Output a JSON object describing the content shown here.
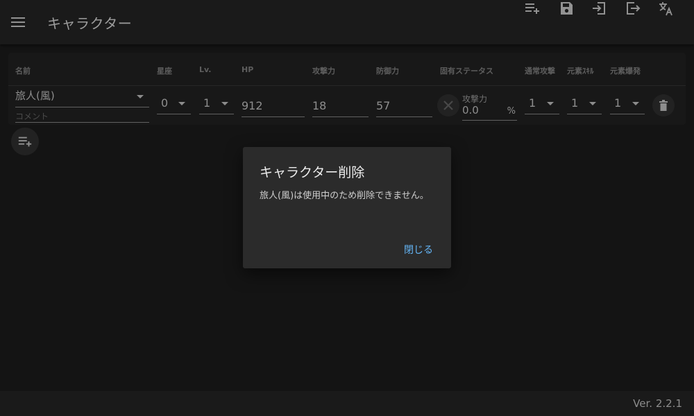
{
  "app": {
    "title": "キャラクター"
  },
  "table": {
    "headers": {
      "name": "名前",
      "constellation": "星座",
      "level": "Lv.",
      "hp": "HP",
      "attack": "攻撃力",
      "defense": "防御力",
      "unique_stat": "固有ステータス",
      "normal_attack": "通常攻撃",
      "elemental_skill": "元素ｽｷﾙ",
      "elemental_burst": "元素爆発"
    },
    "row": {
      "name": "旅人(風)",
      "comment_placeholder": "コメント",
      "constellation": "0",
      "level": "1",
      "hp": "912",
      "attack": "18",
      "defense": "57",
      "unique_stat_label": "攻撃力",
      "unique_stat_value": "0.0",
      "unique_stat_unit": "%",
      "normal_attack": "1",
      "elemental_skill": "1",
      "elemental_burst": "1"
    }
  },
  "dialog": {
    "title": "キャラクター削除",
    "message": "旅人(風)は使用中のため削除できません。",
    "close_label": "閉じる"
  },
  "footer": {
    "version": "Ver. 2.2.1"
  },
  "colors": {
    "accent": "#64b5f6",
    "appbar": "#272727",
    "background": "#1e1e1e"
  },
  "icons": {
    "menu": "menu-icon",
    "add_list": "playlist-add-icon",
    "save": "save-icon",
    "import": "import-icon",
    "export": "export-icon",
    "translate": "translate-icon",
    "clear_stat": "crossed-swords-icon",
    "delete": "trash-icon"
  }
}
